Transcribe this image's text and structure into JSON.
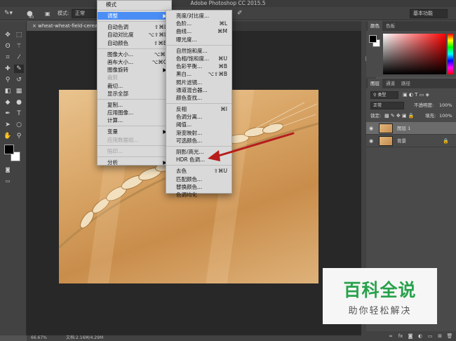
{
  "app": {
    "title": "Adobe Photoshop CC 2015.5"
  },
  "options_bar": {
    "brush_size": "40",
    "mode_label": "模式:",
    "mode_value": "正常",
    "workspace": "基本功能"
  },
  "document": {
    "tab_title": "wheat-wheat-field-cereals",
    "zoom": "66.67%",
    "doc_info": "文档:2.16M/4.29M"
  },
  "image_menu": {
    "top_item": "模式",
    "items": [
      {
        "label": "调整",
        "shortcut": "",
        "highlight": true
      },
      {
        "sep": true
      },
      {
        "label": "自动色调",
        "shortcut": "⇧⌘L"
      },
      {
        "label": "自动对比度",
        "shortcut": "⌥⇧⌘L"
      },
      {
        "label": "自动颜色",
        "shortcut": "⇧⌘B"
      },
      {
        "sep": true
      },
      {
        "label": "图像大小...",
        "shortcut": "⌥⌘I"
      },
      {
        "label": "画布大小...",
        "shortcut": "⌥⌘C"
      },
      {
        "label": "图像旋转",
        "shortcut": "▶"
      },
      {
        "label": "裁剪",
        "shortcut": "",
        "disabled": true
      },
      {
        "label": "裁切...",
        "shortcut": ""
      },
      {
        "label": "显示全部",
        "shortcut": ""
      },
      {
        "sep": true
      },
      {
        "label": "复制...",
        "shortcut": ""
      },
      {
        "label": "应用图像...",
        "shortcut": ""
      },
      {
        "label": "计算...",
        "shortcut": ""
      },
      {
        "sep": true
      },
      {
        "label": "变量",
        "shortcut": "▶"
      },
      {
        "label": "应用数据组...",
        "shortcut": "",
        "disabled": true
      },
      {
        "sep": true
      },
      {
        "label": "陷印...",
        "shortcut": "",
        "disabled": true
      },
      {
        "sep": true
      },
      {
        "label": "分析",
        "shortcut": "▶"
      }
    ]
  },
  "adjust_menu": {
    "items": [
      {
        "label": "亮度/对比度...",
        "shortcut": ""
      },
      {
        "label": "色阶...",
        "shortcut": "⌘L"
      },
      {
        "label": "曲线...",
        "shortcut": "⌘M"
      },
      {
        "label": "曝光度...",
        "shortcut": ""
      },
      {
        "sep": true
      },
      {
        "label": "自然饱和度...",
        "shortcut": ""
      },
      {
        "label": "色相/饱和度...",
        "shortcut": "⌘U"
      },
      {
        "label": "色彩平衡...",
        "shortcut": "⌘B"
      },
      {
        "label": "黑白...",
        "shortcut": "⌥⇧⌘B"
      },
      {
        "label": "照片滤镜...",
        "shortcut": ""
      },
      {
        "label": "通道混合器...",
        "shortcut": ""
      },
      {
        "label": "颜色查找...",
        "shortcut": ""
      },
      {
        "sep": true
      },
      {
        "label": "反相",
        "shortcut": "⌘I"
      },
      {
        "label": "色调分离...",
        "shortcut": ""
      },
      {
        "label": "阈值...",
        "shortcut": ""
      },
      {
        "label": "渐变映射...",
        "shortcut": ""
      },
      {
        "label": "可选颜色...",
        "shortcut": ""
      },
      {
        "sep": true
      },
      {
        "label": "阴影/高光...",
        "shortcut": ""
      },
      {
        "label": "HDR 色调...",
        "shortcut": ""
      },
      {
        "sep": true
      },
      {
        "label": "去色",
        "shortcut": "⇧⌘U"
      },
      {
        "label": "匹配颜色...",
        "shortcut": ""
      },
      {
        "label": "替换颜色...",
        "shortcut": ""
      },
      {
        "label": "色调均化",
        "shortcut": ""
      }
    ]
  },
  "color_panel": {
    "tabs": [
      "颜色",
      "色板"
    ]
  },
  "layers_panel": {
    "tabs": [
      "图层",
      "通道",
      "路径"
    ],
    "filter_label": "类型",
    "blend_mode": "正常",
    "opacity_label": "不透明度:",
    "opacity_value": "100%",
    "lock_label": "锁定:",
    "fill_label": "填充:",
    "fill_value": "100%",
    "layers": [
      {
        "name": "图层 1",
        "selected": true
      },
      {
        "name": "背景",
        "selected": false
      }
    ]
  },
  "watermark": {
    "title": "百科全说",
    "subtitle": "助你轻松解决"
  },
  "colors": {
    "menu_highlight": "#4a8ef5",
    "annotation_arrow": "#b71c1c",
    "watermark_green": "#27a24b"
  }
}
